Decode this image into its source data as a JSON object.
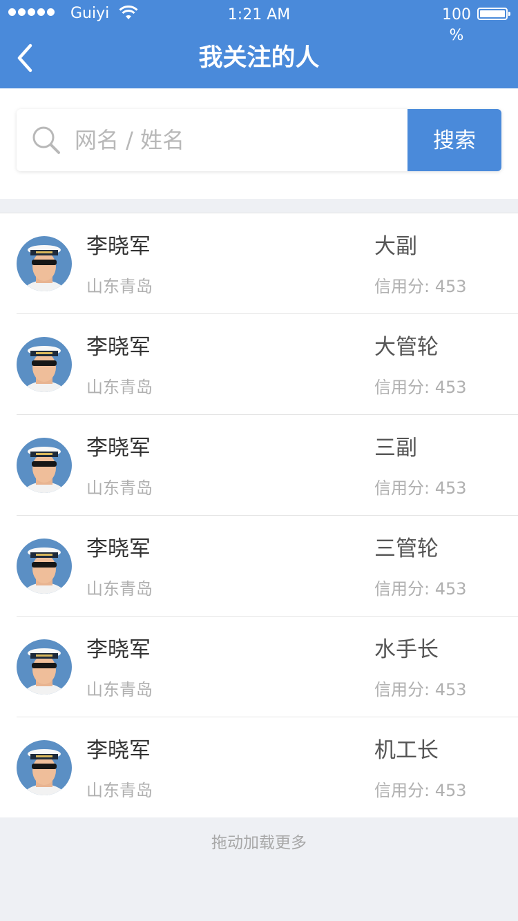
{
  "status_bar": {
    "carrier": "Guiyi",
    "time": "1:21 AM",
    "battery": "100 %"
  },
  "header": {
    "title": "我关注的人",
    "back_icon": "chevron-left-icon"
  },
  "search": {
    "placeholder": "网名 / 姓名",
    "value": "",
    "button_label": "搜索",
    "icon": "search-icon"
  },
  "people": [
    {
      "name": "李晓军",
      "location": "山东青岛",
      "rank": "大副",
      "credit_label": "信用分:",
      "credit": "453"
    },
    {
      "name": "李晓军",
      "location": "山东青岛",
      "rank": "大管轮",
      "credit_label": "信用分:",
      "credit": "453"
    },
    {
      "name": "李晓军",
      "location": "山东青岛",
      "rank": "三副",
      "credit_label": "信用分:",
      "credit": "453"
    },
    {
      "name": "李晓军",
      "location": "山东青岛",
      "rank": "三管轮",
      "credit_label": "信用分:",
      "credit": "453"
    },
    {
      "name": "李晓军",
      "location": "山东青岛",
      "rank": "水手长",
      "credit_label": "信用分:",
      "credit": "453"
    },
    {
      "name": "李晓军",
      "location": "山东青岛",
      "rank": "机工长",
      "credit_label": "信用分:",
      "credit": "453"
    }
  ],
  "footer": {
    "load_more": "拖动加载更多"
  },
  "colors": {
    "brand": "#4a8ada",
    "background": "#eef0f4"
  }
}
